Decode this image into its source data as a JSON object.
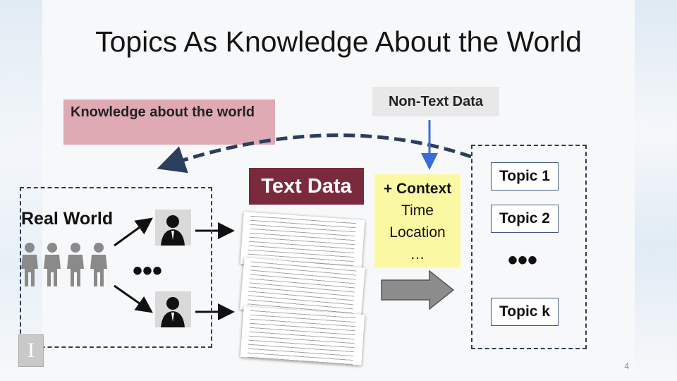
{
  "slide": {
    "title": "Topics As Knowledge About the World",
    "page_number": "4"
  },
  "knowledge_box": {
    "label": "Knowledge about the world"
  },
  "non_text_data": {
    "label": "Non-Text Data"
  },
  "real_world": {
    "label": "Real World",
    "ellipsis": "•••"
  },
  "text_data": {
    "label": "Text Data"
  },
  "context": {
    "heading": "+ Context",
    "items": [
      "Time",
      "Location",
      "…"
    ]
  },
  "topics": {
    "items": [
      "Topic 1",
      "Topic 2",
      "Topic k"
    ],
    "ellipsis": "•••"
  },
  "colors": {
    "text_data_bg": "#7b2a3d",
    "knowledge_bg": "#e0aab4",
    "context_bg": "#fbf8a3",
    "dashed_border": "#2b3e5c",
    "arrow_blue": "#3b6bd8"
  },
  "logo_letter": "I"
}
